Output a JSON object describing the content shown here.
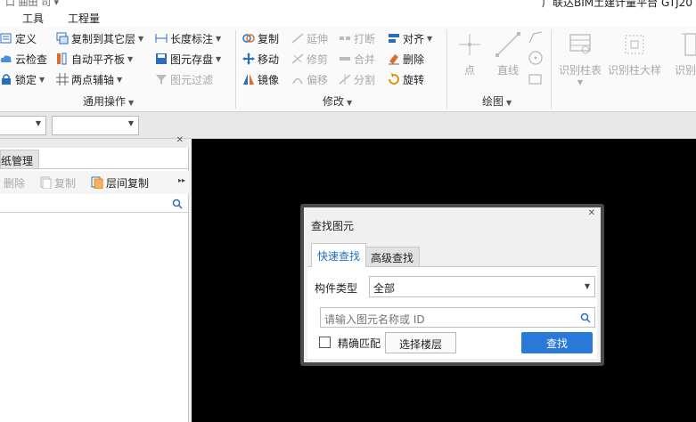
{
  "window": {
    "title": "广联达BIM土建计量平台 GTJ20",
    "quick_access": "口 曲田 司 ▾"
  },
  "menu": {
    "items": [
      "工具",
      "工程量"
    ]
  },
  "ribbon": {
    "general": {
      "col1": [
        "定义",
        "云检查",
        "锁定"
      ],
      "col2": [
        "复制到其它层",
        "自动平齐板",
        "两点辅轴"
      ],
      "col3": [
        "长度标注",
        "图元存盘",
        "图元过滤"
      ],
      "label": "通用操作"
    },
    "modify": {
      "col1": [
        "复制",
        "移动",
        "镜像"
      ],
      "col2": [
        "延伸",
        "修剪",
        "偏移"
      ],
      "col3": [
        "打断",
        "合并",
        "分割"
      ],
      "col4": [
        "对齐",
        "删除",
        "旋转"
      ],
      "label": "修改"
    },
    "draw": {
      "point": "点",
      "line": "直线",
      "label": "绘图"
    },
    "identify": [
      "识别柱表",
      "识别柱大样",
      "识别柱"
    ]
  },
  "left_panel": {
    "tab": "纸管理",
    "toolbar": {
      "delete": "删除",
      "copy": "复制",
      "copy_between_floors": "层间复制",
      "more": "▸▸"
    }
  },
  "dialog": {
    "title": "查找图元",
    "tabs": {
      "quick": "快速查找",
      "advanced": "高级查找"
    },
    "type_label": "构件类型",
    "type_value": "全部",
    "search_placeholder": "请输入图元名称或 ID",
    "exact_match_label": "精确匹配",
    "exact_match_checked": false,
    "select_floor_button": "选择楼层",
    "find_button": "查找"
  },
  "colors": {
    "accent": "#2979d8",
    "canvas": "#000000",
    "dialog_frame": "#4b4b4b"
  }
}
